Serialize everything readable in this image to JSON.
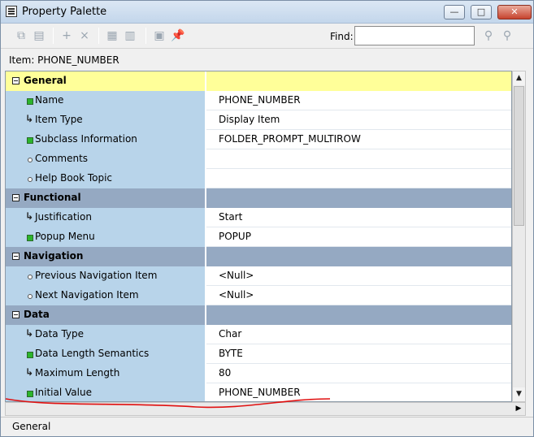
{
  "window": {
    "title": "Property Palette",
    "min_glyph": "—",
    "max_glyph": "□",
    "close_glyph": "✕"
  },
  "toolbar": {
    "icons": [
      "copy-properties-icon",
      "paste-properties-icon",
      "add-property-icon",
      "delete-property-icon",
      "union-icon",
      "intersection-icon",
      "freeze-icon",
      "pin-icon"
    ],
    "find_label": "Find:",
    "find_value": "",
    "search_forward_icon": "flashlight-icon",
    "search_backward_icon": "flashlight-icon"
  },
  "item_label": "Item: PHONE_NUMBER",
  "rows": [
    {
      "kind": "group",
      "label": "General",
      "selected": true
    },
    {
      "kind": "prop",
      "marker": "green",
      "label": "Name",
      "value": "PHONE_NUMBER"
    },
    {
      "kind": "prop",
      "marker": "arrow",
      "label": "Item Type",
      "value": "Display Item"
    },
    {
      "kind": "prop",
      "marker": "green",
      "label": "Subclass Information",
      "value": "FOLDER_PROMPT_MULTIROW"
    },
    {
      "kind": "prop",
      "marker": "dot",
      "label": "Comments",
      "value": ""
    },
    {
      "kind": "prop",
      "marker": "dot",
      "label": "Help Book Topic",
      "value": ""
    },
    {
      "kind": "group",
      "label": "Functional",
      "selected": false
    },
    {
      "kind": "prop",
      "marker": "arrow",
      "label": "Justification",
      "value": "Start"
    },
    {
      "kind": "prop",
      "marker": "green",
      "label": "Popup Menu",
      "value": "POPUP"
    },
    {
      "kind": "group",
      "label": "Navigation",
      "selected": false
    },
    {
      "kind": "prop",
      "marker": "dot",
      "label": "Previous Navigation Item",
      "value": "<Null>"
    },
    {
      "kind": "prop",
      "marker": "dot",
      "label": "Next Navigation Item",
      "value": "<Null>"
    },
    {
      "kind": "group",
      "label": "Data",
      "selected": false
    },
    {
      "kind": "prop",
      "marker": "arrow",
      "label": "Data Type",
      "value": "Char"
    },
    {
      "kind": "prop",
      "marker": "green",
      "label": "Data Length Semantics",
      "value": "BYTE"
    },
    {
      "kind": "prop",
      "marker": "arrow",
      "label": "Maximum Length",
      "value": "80"
    },
    {
      "kind": "prop",
      "marker": "green",
      "label": "Initial Value",
      "value": "PHONE_NUMBER"
    }
  ],
  "status": "General",
  "colors": {
    "group_bg": "#95a9c2",
    "selected_group_bg": "#ffff99",
    "name_cell_bg": "#b8d4ea",
    "annotation_stroke": "#e01010"
  }
}
